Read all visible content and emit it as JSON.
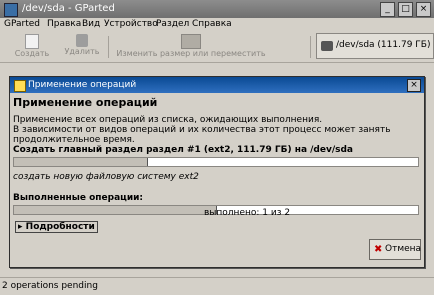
{
  "window": {
    "title": "/dev/sda - GParted"
  },
  "menu": [
    "GParted",
    "Правка",
    "Вид",
    "Устройство",
    "Раздел",
    "Справка"
  ],
  "toolbar": {
    "new_label": "Создать",
    "delete_label": "Удалить",
    "resize_label": "Изменить размер или переместить",
    "device_label": "/dev/sda   (111.79 ГБ)"
  },
  "statusbar": {
    "text": "2 operations pending"
  },
  "dialog": {
    "title": "Применение операций",
    "heading": "Применение операций",
    "description_line1": "Применение всех операций из списка, ожидающих выполнения.",
    "description_line2": "В зависимости от видов операций и их количества этот процесс может занять продолжительное время.",
    "current_operation": "Создать главный раздел раздел #1 (ext2, 111.79 ГБ) на /dev/sda",
    "current_progress": 0.33,
    "current_suboperation": "создать новую файловую систему ext2",
    "completed_label": "Выполненные операции:",
    "completed_progress": 0.5,
    "completed_count": "выполнено: 1 из 2",
    "details_label": "Подробности",
    "cancel_label": "Отмена"
  }
}
